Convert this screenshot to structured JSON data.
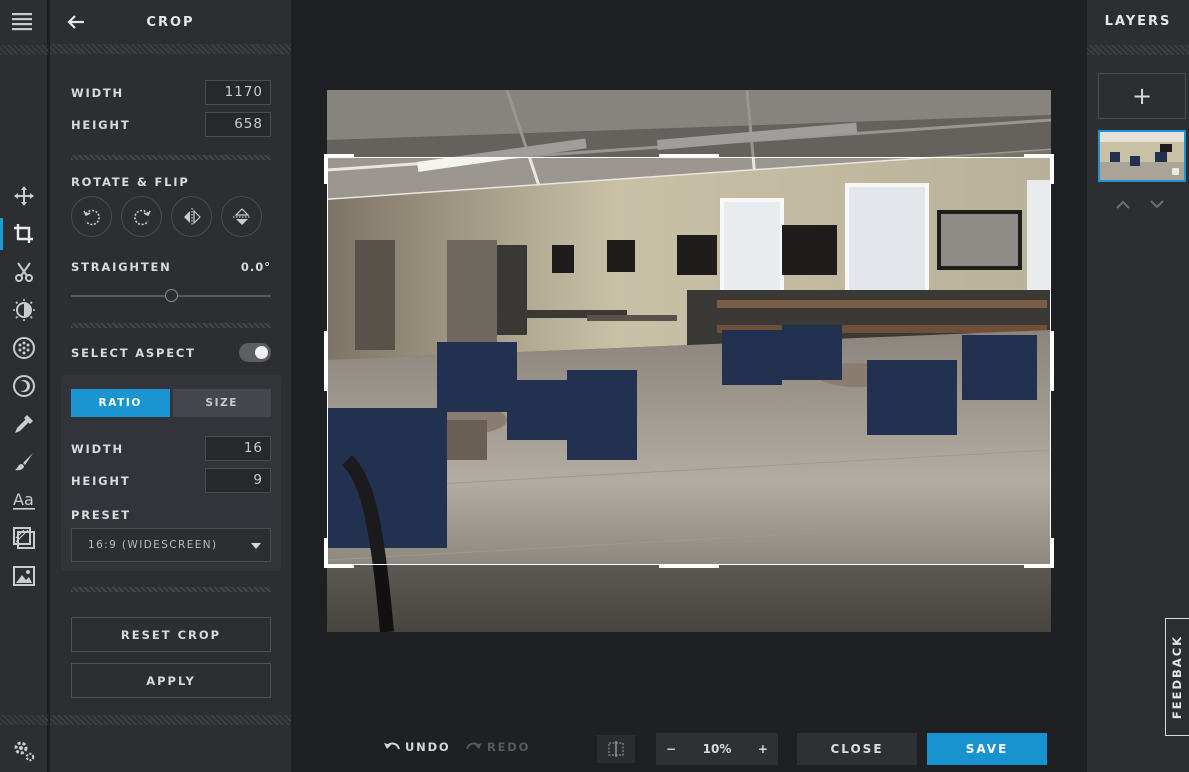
{
  "panel": {
    "title": "CROP",
    "width_label": "WIDTH",
    "width_value": "1170",
    "height_label": "HEIGHT",
    "height_value": "658",
    "rotate_label": "ROTATE & FLIP",
    "straighten_label": "STRAIGHTEN",
    "straighten_value": "0.0°",
    "straighten_level": 0.5,
    "aspect_label": "SELECT ASPECT",
    "aspect_toggle_on": true,
    "tabs": {
      "ratio": "RATIO",
      "size": "SIZE",
      "active": "ratio"
    },
    "ratio_width_label": "WIDTH",
    "ratio_width_value": "16",
    "ratio_height_label": "HEIGHT",
    "ratio_height_value": "9",
    "preset_label": "PRESET",
    "preset_value": "16:9 (WIDESCREEN)",
    "reset_label": "RESET CROP",
    "apply_label": "APPLY"
  },
  "tools": [
    "menu-icon",
    "move-icon",
    "crop-icon",
    "cut-icon",
    "adjust-icon",
    "filter-icon",
    "vignette-icon",
    "picker-icon",
    "brush-icon",
    "text-icon",
    "frame-icon",
    "image-icon",
    "settings-icon"
  ],
  "bottombar": {
    "undo": "UNDO",
    "redo": "REDO",
    "zoom_minus": "−",
    "zoom_value": "10%",
    "zoom_plus": "+",
    "close": "CLOSE",
    "save": "SAVE"
  },
  "layers": {
    "title": "LAYERS",
    "add": "+"
  },
  "feedback": "FEEDBACK",
  "colors": {
    "accent": "#1a95d1",
    "panel": "#2c2e32",
    "canvas": "#1f2023"
  }
}
